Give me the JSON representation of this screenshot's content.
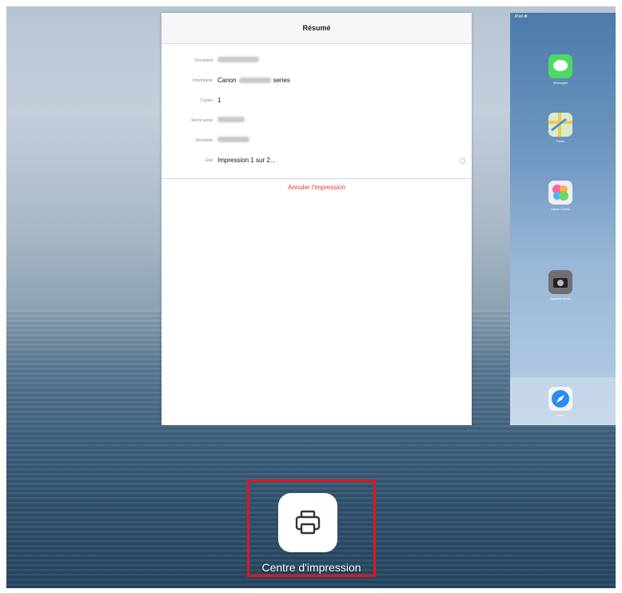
{
  "summary": {
    "title": "Résumé",
    "rows": [
      {
        "label": "Document",
        "value": ""
      },
      {
        "label": "Imprimante",
        "value_prefix": "Canon",
        "value_suffix": "series"
      },
      {
        "label": "Copies",
        "value": "1"
      },
      {
        "label": "Recto verso",
        "value": ""
      },
      {
        "label": "Demande",
        "value": ""
      },
      {
        "label": "État",
        "value": "Impression 1 sur 2..."
      }
    ],
    "cancel_label": "Annuler l'impression"
  },
  "home_screen": {
    "status_text": "iPad ✱",
    "apps": [
      {
        "label": "Messages",
        "icon": "messages-icon",
        "color": "#4cd964"
      },
      {
        "label": "Plans",
        "icon": "maps-icon",
        "color": "#8ed07a"
      },
      {
        "label": "Game Center",
        "icon": "game-center-icon",
        "color": "#e9e9ee"
      },
      {
        "label": "Appareil photo",
        "icon": "camera-icon",
        "color": "#3a3a3c"
      }
    ],
    "dock": [
      {
        "label": "Safari",
        "icon": "safari-icon",
        "color": "#1e90ff"
      }
    ]
  },
  "print_center": {
    "label": "Centre d'impression",
    "icon": "printer-icon"
  },
  "colors": {
    "cancel": "#e03c2f",
    "highlight": "#e5141f"
  }
}
